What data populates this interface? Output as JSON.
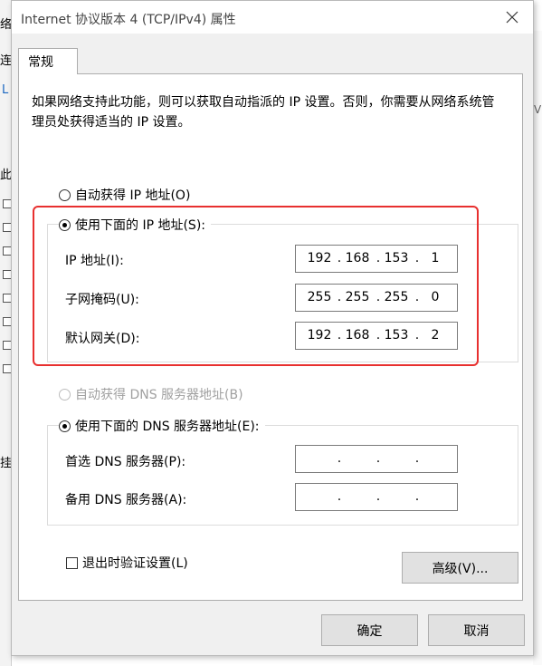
{
  "background": {
    "left_fragments": [
      "络",
      "连",
      "L",
      "此",
      "挂"
    ],
    "right_fragment": "V"
  },
  "dialog": {
    "title": "Internet 协议版本 4 (TCP/IPv4) 属性",
    "close_icon": "close-icon",
    "tab_label": "常规",
    "description": "如果网络支持此功能，则可以获取自动指派的 IP 设置。否则，你需要从网络系统管理员处获得适当的 IP 设置。",
    "ip_auto_label": "自动获得 IP 地址(O)",
    "ip_manual_label": "使用下面的 IP 地址(S):",
    "ip_fields": [
      {
        "label": "IP 地址(I):",
        "octets": [
          "192",
          "168",
          "153",
          "1"
        ]
      },
      {
        "label": "子网掩码(U):",
        "octets": [
          "255",
          "255",
          "255",
          "0"
        ]
      },
      {
        "label": "默认网关(D):",
        "octets": [
          "192",
          "168",
          "153",
          "2"
        ]
      }
    ],
    "dns_auto_label": "自动获得 DNS 服务器地址(B)",
    "dns_manual_label": "使用下面的 DNS 服务器地址(E):",
    "dns_fields": [
      {
        "label": "首选 DNS 服务器(P):",
        "octets": [
          "",
          "",
          "",
          ""
        ]
      },
      {
        "label": "备用 DNS 服务器(A):",
        "octets": [
          "",
          "",
          "",
          ""
        ]
      }
    ],
    "validate_label": "退出时验证设置(L)",
    "advanced_button": "高级(V)...",
    "ok_button": "确定",
    "cancel_button": "取消",
    "highlight_color": "#e8302f"
  }
}
